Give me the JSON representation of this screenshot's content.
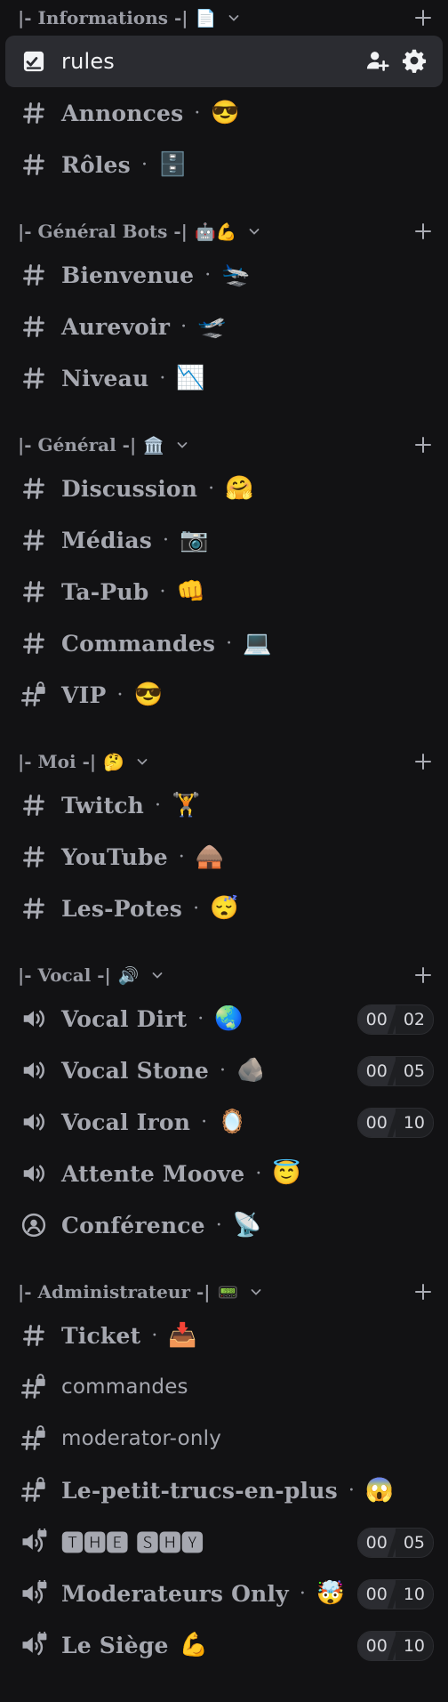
{
  "categories": [
    {
      "label": "|- Informations -|",
      "emoji": "📄",
      "channels": [
        {
          "name": "rules",
          "icon": "rules-icon",
          "selected": true
        },
        {
          "name": "Annonces",
          "sep": "·",
          "emoji": "😎"
        },
        {
          "name": "Rôles",
          "sep": "·",
          "emoji": "🗄️"
        }
      ]
    },
    {
      "label": "|- Général Bots -|",
      "emoji": "🤖💪",
      "channels": [
        {
          "name": "Bienvenue",
          "sep": "·",
          "emoji": "🛬"
        },
        {
          "name": "Aurevoir",
          "sep": "·",
          "emoji": "🛫"
        },
        {
          "name": "Niveau",
          "sep": "·",
          "emoji": "📉"
        }
      ]
    },
    {
      "label": "|- Général -|",
      "emoji": "🏛️",
      "channels": [
        {
          "name": "Discussion",
          "sep": "·",
          "emoji": "🤗"
        },
        {
          "name": "Médias",
          "sep": "·",
          "emoji": "📷"
        },
        {
          "name": "Ta-Pub",
          "sep": "·",
          "emoji": "👊"
        },
        {
          "name": "Commandes",
          "sep": "·",
          "emoji": "💻"
        },
        {
          "name": "VIP",
          "sep": "·",
          "emoji": "😎",
          "icon": "locked-hash-icon"
        }
      ]
    },
    {
      "label": "|- Moi -|",
      "emoji": "🤔",
      "channels": [
        {
          "name": "Twitch",
          "sep": "·",
          "emoji": "🏋️"
        },
        {
          "name": "YouTube",
          "sep": "·",
          "emoji": "🛖"
        },
        {
          "name": "Les-Potes",
          "sep": "·",
          "emoji": "😴"
        }
      ]
    },
    {
      "label": "|- Vocal -|",
      "emoji": "🔊",
      "channels": [
        {
          "name": "Vocal Dirt",
          "sep": "·",
          "emoji": "🌏",
          "icon": "speaker-icon",
          "badge": [
            "00",
            "02"
          ]
        },
        {
          "name": "Vocal Stone",
          "sep": "·",
          "emoji": "🪨",
          "icon": "speaker-icon",
          "badge": [
            "00",
            "05"
          ]
        },
        {
          "name": "Vocal Iron",
          "sep": "·",
          "emoji": "🪞",
          "icon": "speaker-icon",
          "badge": [
            "00",
            "10"
          ]
        },
        {
          "name": "Attente Moove",
          "sep": "·",
          "emoji": "😇",
          "icon": "speaker-icon"
        },
        {
          "name": "Conférence",
          "sep": "·",
          "emoji": "📡",
          "icon": "stage-icon"
        }
      ]
    },
    {
      "label": "|- Administrateur -|",
      "emoji": "📟",
      "channels": [
        {
          "name": "Ticket",
          "sep": "·",
          "emoji": "📥"
        },
        {
          "name": "commandes",
          "icon": "locked-hash-icon",
          "sans": true
        },
        {
          "name": "moderator-only",
          "icon": "locked-hash-icon",
          "sans": true
        },
        {
          "name": "Le-petit-trucs-en-plus",
          "sep": "·",
          "emoji": "😱",
          "icon": "locked-hash-icon"
        },
        {
          "name": "🆃🅷🅴 🆂🅷🆈",
          "icon": "locked-speaker-icon",
          "badge": [
            "00",
            "05"
          ]
        },
        {
          "name": "Moderateurs Only",
          "sep": "·",
          "emoji": "🤯",
          "icon": "locked-speaker-icon",
          "badge": [
            "00",
            "10"
          ]
        },
        {
          "name": "Le Siège",
          "emoji": "💪",
          "icon": "locked-speaker-icon",
          "badge": [
            "00",
            "10"
          ]
        }
      ]
    }
  ]
}
